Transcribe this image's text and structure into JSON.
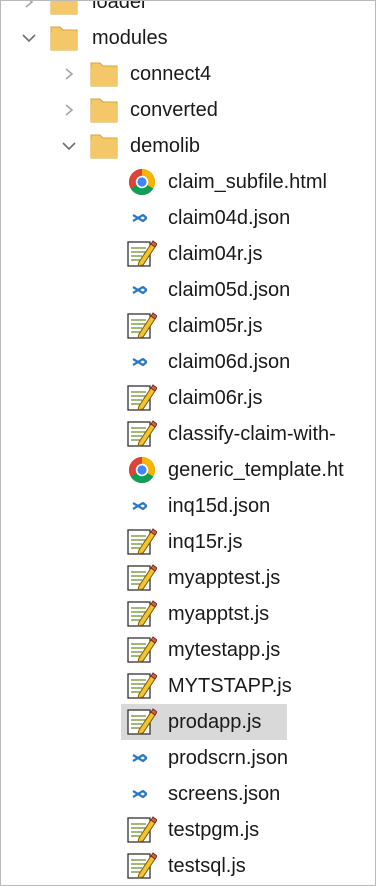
{
  "colors": {
    "folder_fill": "#f4c869",
    "folder_edge": "#d9a43a",
    "selection": "#d9d9d9",
    "json_icon": "#2a78c6"
  },
  "tree": {
    "items": [
      {
        "label": "loader",
        "level": 0,
        "type": "folder",
        "state": "collapsed"
      },
      {
        "label": "modules",
        "level": 0,
        "type": "folder",
        "state": "expanded"
      },
      {
        "label": "connect4",
        "level": 1,
        "type": "folder",
        "state": "collapsed"
      },
      {
        "label": "converted",
        "level": 1,
        "type": "folder",
        "state": "collapsed"
      },
      {
        "label": "demolib",
        "level": 1,
        "type": "folder",
        "state": "expanded"
      },
      {
        "label": "claim_subfile.html",
        "level": 2,
        "type": "chrome-html"
      },
      {
        "label": "claim04d.json",
        "level": 2,
        "type": "json"
      },
      {
        "label": "claim04r.js",
        "level": 2,
        "type": "js"
      },
      {
        "label": "claim05d.json",
        "level": 2,
        "type": "json"
      },
      {
        "label": "claim05r.js",
        "level": 2,
        "type": "js"
      },
      {
        "label": "claim06d.json",
        "level": 2,
        "type": "json"
      },
      {
        "label": "claim06r.js",
        "level": 2,
        "type": "js"
      },
      {
        "label": "classify-claim-with-",
        "level": 2,
        "type": "js"
      },
      {
        "label": "generic_template.ht",
        "level": 2,
        "type": "chrome-html"
      },
      {
        "label": "inq15d.json",
        "level": 2,
        "type": "json"
      },
      {
        "label": "inq15r.js",
        "level": 2,
        "type": "js"
      },
      {
        "label": "myapptest.js",
        "level": 2,
        "type": "js"
      },
      {
        "label": "myapptst.js",
        "level": 2,
        "type": "js"
      },
      {
        "label": "mytestapp.js",
        "level": 2,
        "type": "js"
      },
      {
        "label": "MYTSTAPP.js",
        "level": 2,
        "type": "js"
      },
      {
        "label": "prodapp.js",
        "level": 2,
        "type": "js",
        "selected": true
      },
      {
        "label": "prodscrn.json",
        "level": 2,
        "type": "json"
      },
      {
        "label": "screens.json",
        "level": 2,
        "type": "json"
      },
      {
        "label": "testpgm.js",
        "level": 2,
        "type": "js"
      },
      {
        "label": "testsql.js",
        "level": 2,
        "type": "js"
      }
    ]
  }
}
